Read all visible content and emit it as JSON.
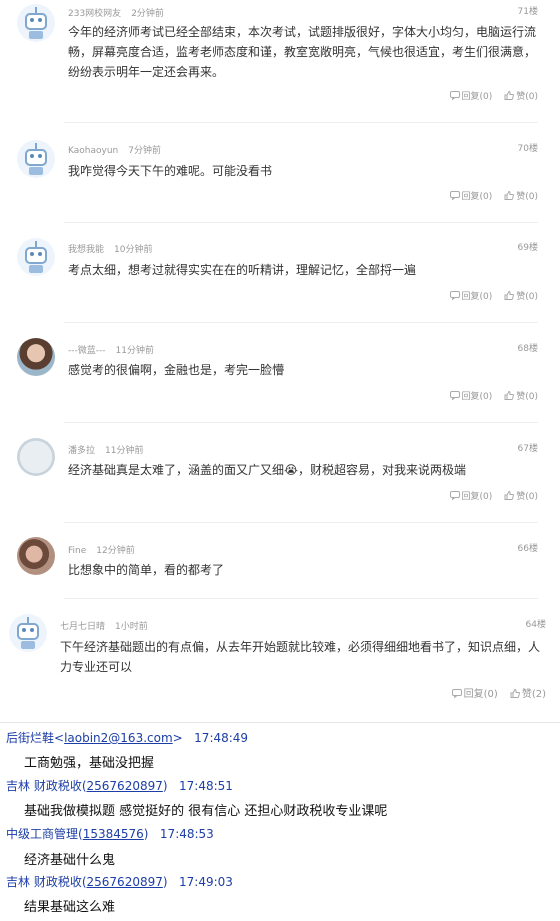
{
  "posts": [
    {
      "user": "233网校网友",
      "time": "2分钟前",
      "floor": "71楼",
      "text": "今年的经济师考试已经全部结束，本次考试，试题排版很好，字体大小均匀，电脑运行流畅，屏幕亮度合适，监考老师态度和谨，教室宽敞明亮，气候也很适宜，考生们很满意，纷纷表示明年一定还会再来。",
      "reply": "回复(0)",
      "like": "赞(0)",
      "avatar": "robot-avatar"
    },
    {
      "user": "Kaohaoyun",
      "time": "7分钟前",
      "floor": "70楼",
      "text": "我咋觉得今天下午的难呢。可能没看书",
      "reply": "回复(0)",
      "like": "赞(0)",
      "avatar": "robot-avatar"
    },
    {
      "user": "我想我能",
      "time": "10分钟前",
      "floor": "69楼",
      "text": "考点太细，想考过就得实实在在的听精讲，理解记忆，全部捋一遍",
      "reply": "回复(0)",
      "like": "赞(0)",
      "avatar": "robot-avatar"
    },
    {
      "user": "---微蓝---",
      "time": "11分钟前",
      "floor": "68楼",
      "text": "感觉考的很偏啊，金融也是，考完一脸懵",
      "reply": "回复(0)",
      "like": "赞(0)",
      "avatar": "photo-avatar"
    },
    {
      "user": "潘多拉",
      "time": "11分钟前",
      "floor": "67楼",
      "text": "经济基础真是太难了，涵盖的面又广又细😭，财税超容易，对我来说两极端",
      "reply": "回复(0)",
      "like": "赞(0)",
      "avatar": "photo-avatar"
    },
    {
      "user": "Fine",
      "time": "12分钟前",
      "floor": "66楼",
      "text": "比想象中的简单，看的都考了",
      "reply": "",
      "like": "",
      "avatar": "photo-avatar"
    },
    {
      "user": "七月七日晴",
      "time": "1小时前",
      "floor": "64楼",
      "text": "下午经济基础题出的有点偏，从去年开始题就比较难，必须得细细地看书了，知识点细，人力专业还可以",
      "reply": "回复(0)",
      "like": "赞(2)",
      "avatar": "robot-avatar"
    }
  ],
  "chat": [
    {
      "name": "后街烂鞋",
      "email": "laobin2@163.com",
      "lt": "<",
      "gt": ">",
      "time": "17:48:49",
      "message": "工商勉强，基础没把握"
    },
    {
      "name": "吉林 财政税收",
      "qq": "2567620897",
      "time": "17:48:51",
      "message": "基础我做模拟题 感觉挺好的 很有信心 还担心财政税收专业课呢"
    },
    {
      "name": "中级工商管理",
      "qq": "15384576",
      "time": "17:48:53",
      "message": "经济基础什么鬼"
    },
    {
      "name": "吉林 财政税收",
      "qq": "2567620897",
      "time": "17:49:03",
      "message": "结果基础这么难"
    }
  ],
  "colors": {
    "link": "#1c3ea6",
    "meta": "#999999",
    "text": "#333333"
  }
}
